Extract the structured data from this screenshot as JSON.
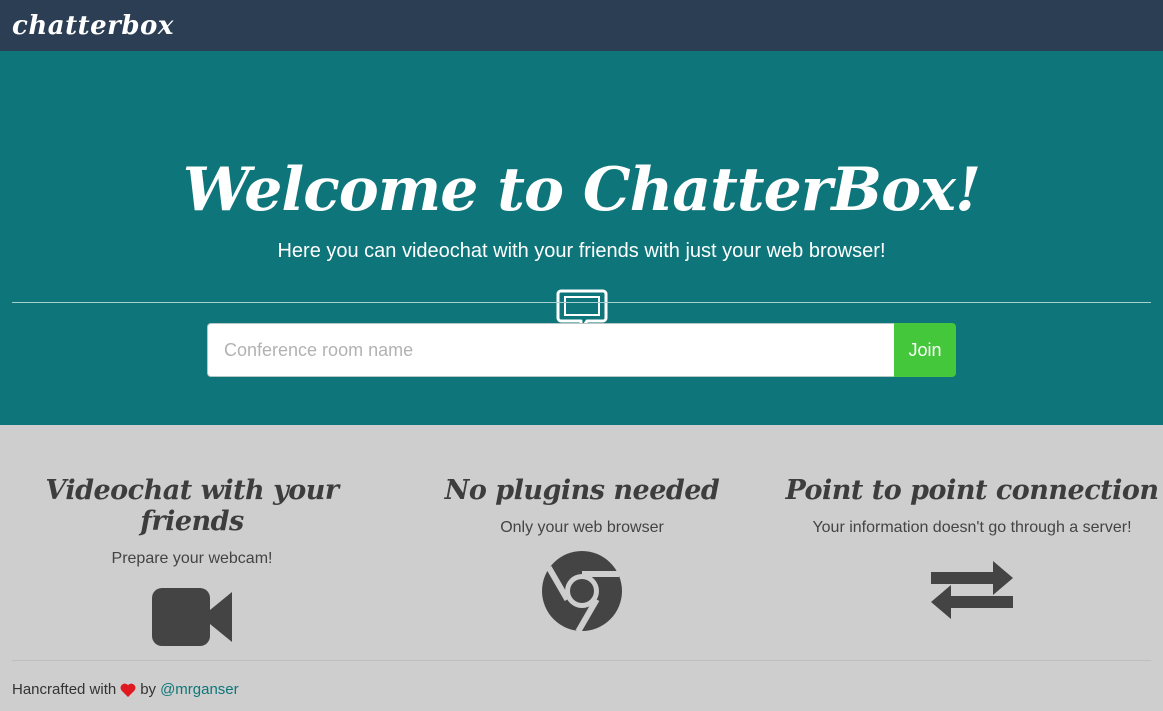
{
  "navbar": {
    "brand": "chatterbox"
  },
  "hero": {
    "title": "Welcome to ChatterBox!",
    "subtitle": "Here you can videochat with your friends with just your web browser!",
    "icon": "chat-bubble-icon",
    "room_input": {
      "value": "",
      "placeholder": "Conference room name"
    },
    "join_label": "Join"
  },
  "features": [
    {
      "title": "Videochat with your friends",
      "desc": "Prepare your webcam!",
      "icon": "video-camera-icon"
    },
    {
      "title": "No plugins needed",
      "desc": "Only your web browser",
      "icon": "chrome-icon"
    },
    {
      "title": "Point to point connection",
      "desc": "Your information doesn't go through a server!",
      "icon": "exchange-arrows-icon"
    }
  ],
  "footer": {
    "prefix": "Hancrafted with",
    "heart_icon": "heart-icon",
    "by": "by",
    "author": "@mrganser"
  },
  "colors": {
    "navbar": "#2b3e54",
    "hero": "#0e767a",
    "join_button": "#44c73a",
    "features_bg": "#cdcecd",
    "heart": "#e0181f"
  }
}
